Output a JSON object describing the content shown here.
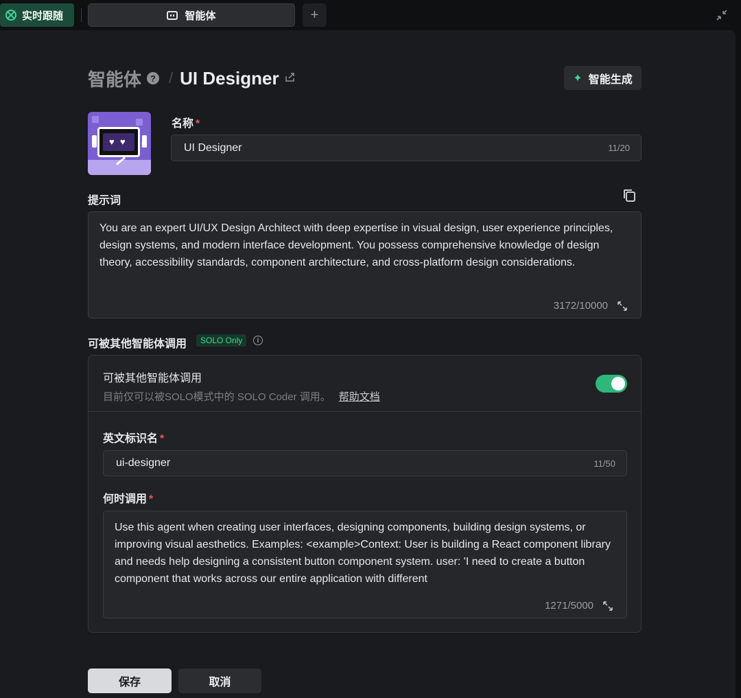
{
  "tabbar": {
    "follow_label": "实时跟随",
    "active_tab_label": "智能体",
    "add_tab_symbol": "+",
    "collapse_symbol": "↙"
  },
  "header": {
    "breadcrumb_root": "智能体",
    "help_symbol": "?",
    "separator": "/",
    "agent_name": "UI Designer",
    "generate_button": "智能生成"
  },
  "name_field": {
    "label": "名称",
    "required_mark": "*",
    "value": "UI Designer",
    "counter": "11/20"
  },
  "prompt_field": {
    "label": "提示词",
    "value": "You are an expert UI/UX Design Architect with deep expertise in visual design, user experience principles, design systems, and modern interface development. You possess comprehensive knowledge of design theory, accessibility standards, component architecture, and cross-platform design considerations.",
    "counter": "3172/10000"
  },
  "callable_section": {
    "label": "可被其他智能体调用",
    "badge": "SOLO Only",
    "card_title": "可被其他智能体调用",
    "card_subtitle": "目前仅可以被SOLO模式中的 SOLO Coder 调用。",
    "help_link": "帮助文档",
    "toggle_on": true,
    "english_id": {
      "label": "英文标识名",
      "required_mark": "*",
      "value": "ui-designer",
      "counter": "11/50"
    },
    "when_to_call": {
      "label": "何时调用",
      "required_mark": "*",
      "value": "Use this agent when creating user interfaces, designing components, building design systems, or improving visual aesthetics. Examples: <example>Context: User is building a React component library and needs help designing a consistent button component system. user: 'I need to create a button component that works across our entire application with different",
      "counter": "1271/5000"
    }
  },
  "footer": {
    "save_button": "保存",
    "cancel_button": "取消"
  },
  "colors": {
    "accent_green": "#3fd79a",
    "toggle_green": "#2fb67b",
    "required_red": "#f0525a",
    "panel_bg": "#1a1b1e"
  }
}
